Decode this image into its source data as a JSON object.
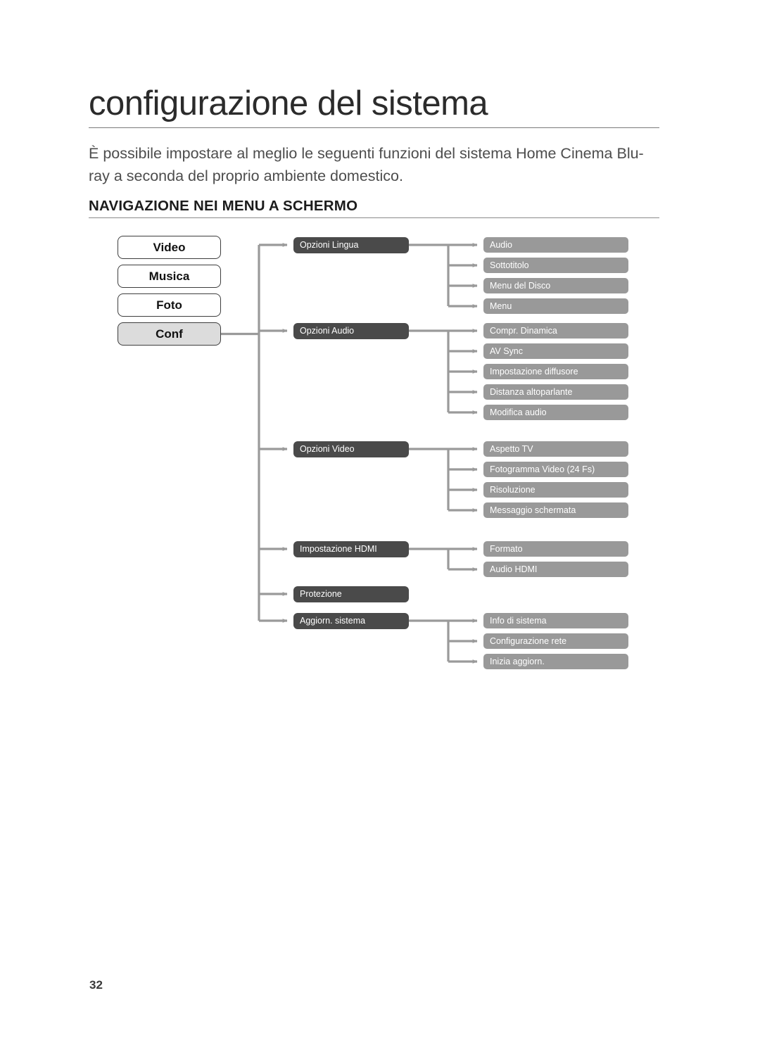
{
  "document": {
    "title": "configurazione del sistema",
    "intro": "È possibile impostare al meglio le seguenti funzioni del sistema Home Cinema Blu-ray a seconda del proprio ambiente domestico.",
    "section_heading": "NAVIGAZIONE NEI MENU A SCHERMO",
    "page_number": "32"
  },
  "colors": {
    "dark_node": "#4a4a4a",
    "gray_node": "#999999",
    "selected_node": "#dcdcdc",
    "connector": "#9a9a9a",
    "rule": "#7a7a7a"
  },
  "diagram": {
    "type": "tree",
    "top_level": [
      {
        "label": "Video",
        "selected": false
      },
      {
        "label": "Musica",
        "selected": false
      },
      {
        "label": "Foto",
        "selected": false
      },
      {
        "label": "Conf",
        "selected": true
      }
    ],
    "branches": [
      {
        "label": "Opzioni Lingua",
        "children": [
          "Audio",
          "Sottotitolo",
          "Menu del Disco",
          "Menu"
        ]
      },
      {
        "label": "Opzioni Audio",
        "children": [
          "Compr. Dinamica",
          "AV Sync",
          "Impostazione diffusore",
          "Distanza altoparlante",
          "Modifica audio"
        ]
      },
      {
        "label": "Opzioni Video",
        "children": [
          "Aspetto TV",
          "Fotogramma Video (24 Fs)",
          "Risoluzione",
          "Messaggio schermata"
        ]
      },
      {
        "label": "Impostazione HDMI",
        "children": [
          "Formato",
          "Audio HDMI"
        ]
      },
      {
        "label": "Protezione",
        "children": []
      },
      {
        "label": "Aggiorn. sistema",
        "children": [
          "Info di sistema",
          "Configurazione rete",
          "Inizia aggiorn."
        ]
      }
    ]
  }
}
